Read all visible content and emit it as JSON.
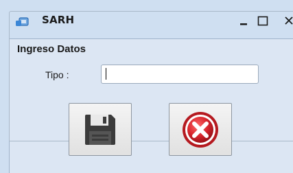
{
  "window": {
    "title": "SARH",
    "icons": {
      "app": "app-window-icon",
      "minimize": "minimize-icon",
      "maximize": "maximize-icon",
      "close": "close-icon"
    }
  },
  "form": {
    "group_title": "Ingreso Datos",
    "tipo_label": "Tipo :",
    "tipo_value": ""
  },
  "actions": {
    "save_icon": "floppy-disk-icon",
    "cancel_icon": "cancel-x-icon"
  },
  "colors": {
    "titlebar": "#cfdff1",
    "client": "#dce6f3",
    "cancel_red": "#d8262d",
    "floppy": "#3d3d3d"
  }
}
